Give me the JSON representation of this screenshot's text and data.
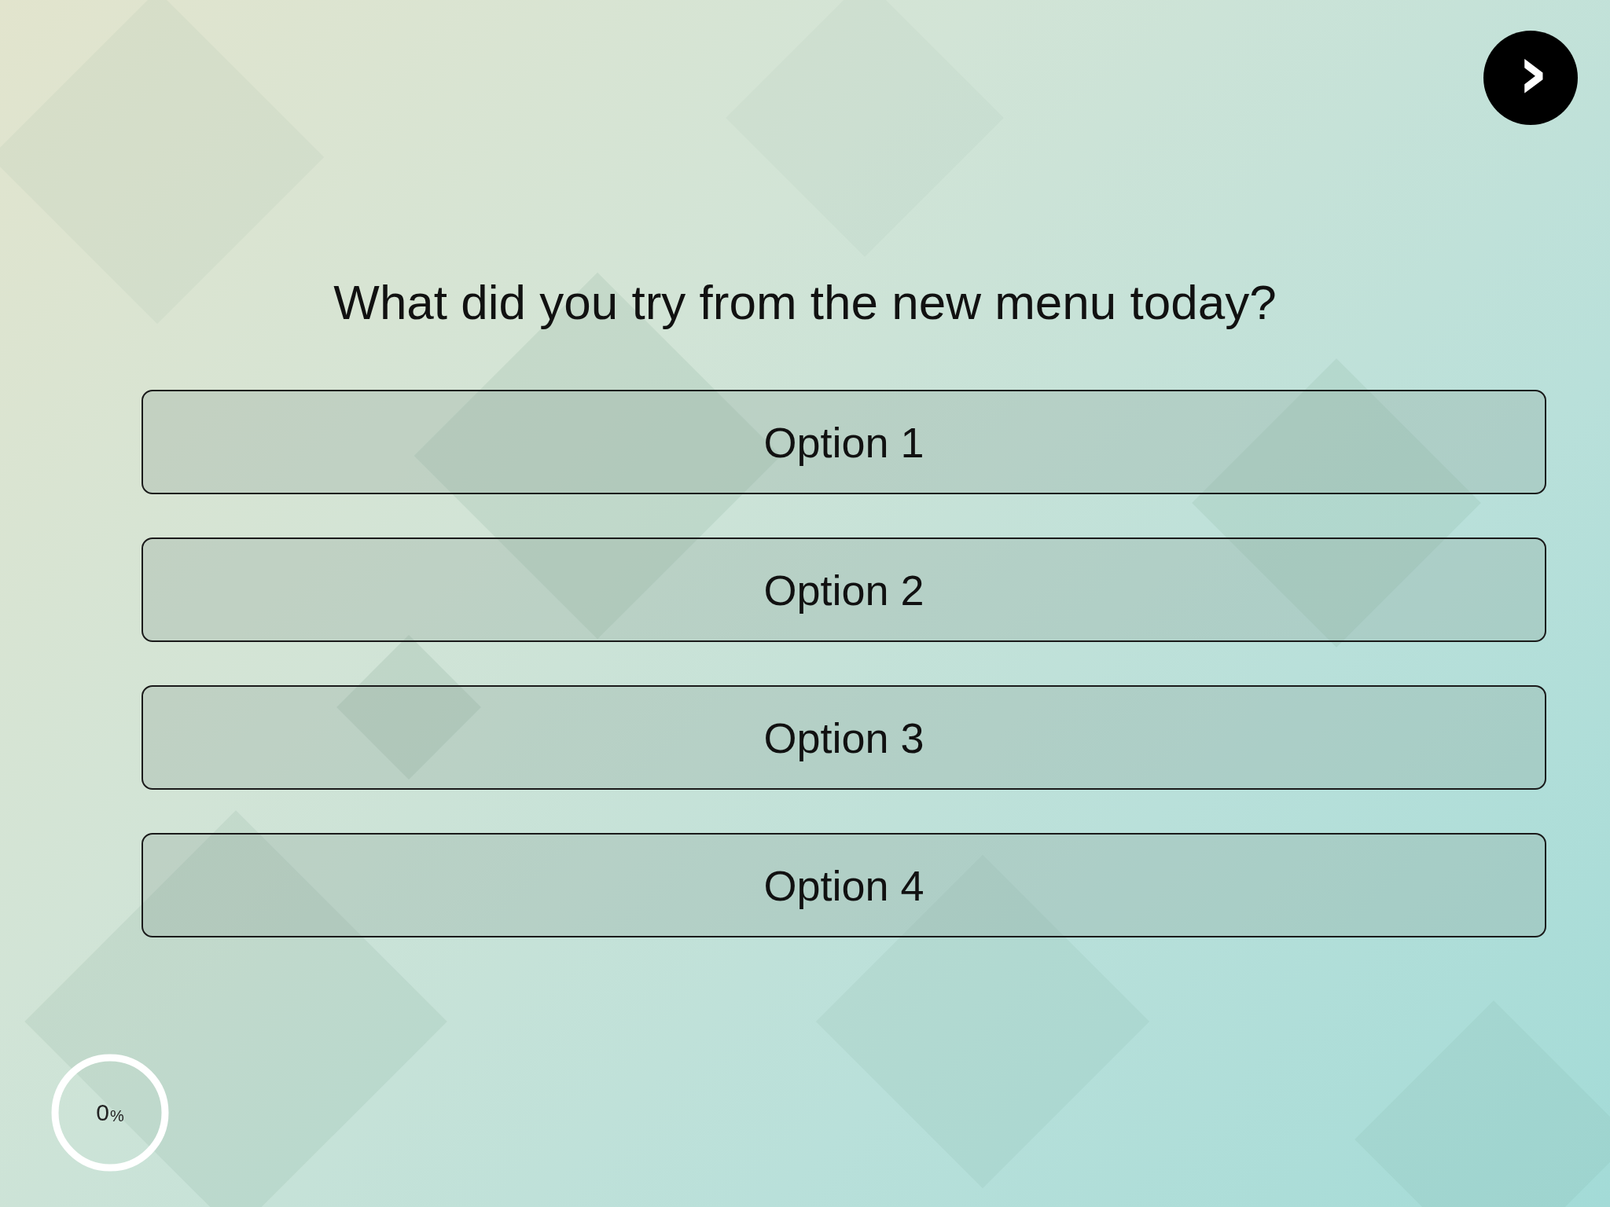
{
  "next_button": {
    "label": "›"
  },
  "question": "What did you try from the new menu today?",
  "options": [
    {
      "label": "Option 1",
      "selected": false
    },
    {
      "label": "Option 2",
      "selected": false
    },
    {
      "label": "Option 3",
      "selected": false
    },
    {
      "label": "Option 4",
      "selected": false
    }
  ],
  "progress": {
    "value": "0",
    "unit": "%",
    "level": 0
  }
}
